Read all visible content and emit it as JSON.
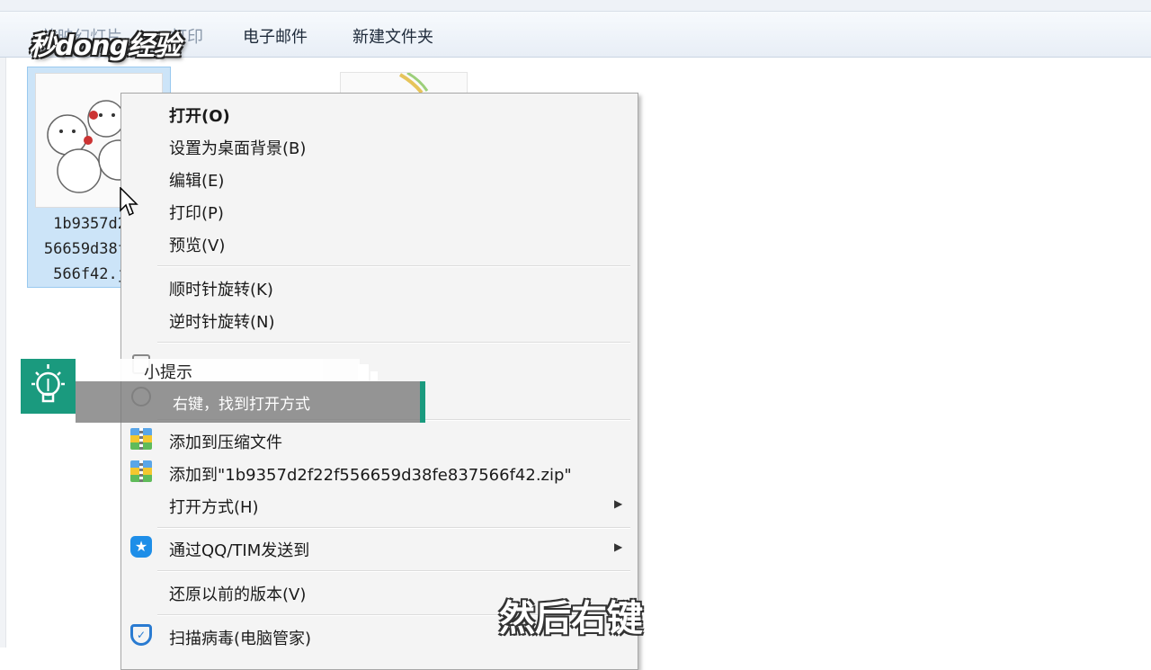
{
  "toolbar": {
    "buttons": [
      "放映幻灯片",
      "打印",
      "电子邮件",
      "新建文件夹"
    ]
  },
  "watermark": {
    "logo_text": "秒dong经验"
  },
  "file": {
    "name_lines": [
      "1b9357d2",
      "56659d38f",
      "566f42.j"
    ]
  },
  "context_menu": {
    "items": [
      {
        "label": "打开(O)"
      },
      {
        "label": "设置为桌面背景(B)"
      },
      {
        "label": "编辑(E)"
      },
      {
        "label": "打印(P)"
      },
      {
        "label": "预览(V)"
      },
      {
        "label": "顺时针旋转(K)"
      },
      {
        "label": "逆时针旋转(N)"
      },
      {
        "label": "添加到压缩文件",
        "icon": "zip-icon"
      },
      {
        "label": "添加到\"1b9357d2f22f556659d38fe837566f42.zip\"",
        "icon": "zip-icon"
      },
      {
        "label": "打开方式(H)",
        "submenu": true
      },
      {
        "label": "通过QQ/TIM发送到",
        "icon": "qq-icon",
        "submenu": true
      },
      {
        "label": "还原以前的版本(V)"
      },
      {
        "label": "扫描病毒(电脑管家)",
        "icon": "shield-icon"
      }
    ]
  },
  "tip": {
    "title": "小提示",
    "body": "右键，找到打开方式"
  },
  "subtitle": "然后右键",
  "colors": {
    "tip_accent": "#1a9a7e",
    "selection": "#cce4f8",
    "menu_bg": "#f4f4f4"
  }
}
